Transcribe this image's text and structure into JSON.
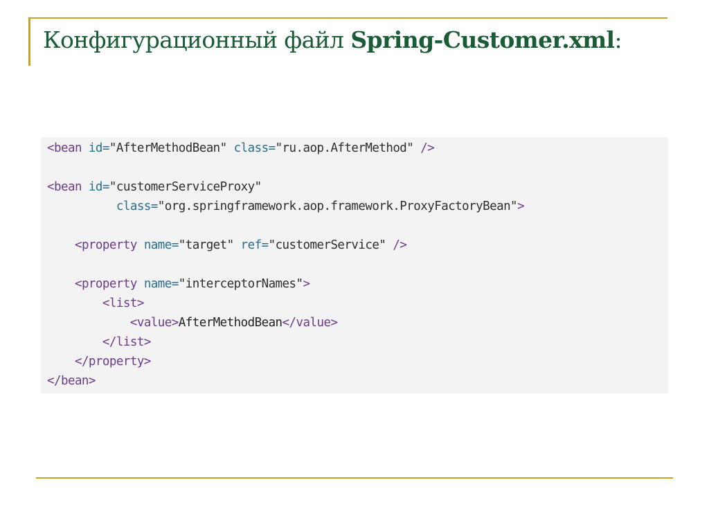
{
  "title": {
    "prefix": "Конфигурационный файл ",
    "filename": "Spring-Customer.xml",
    "suffix": ":"
  },
  "code": {
    "lines": [
      {
        "tokens": [
          {
            "t": "tag",
            "v": "<bean "
          },
          {
            "t": "attr",
            "v": "id="
          },
          {
            "t": "str",
            "v": "\"AfterMethodBean\" "
          },
          {
            "t": "attr",
            "v": "class="
          },
          {
            "t": "str",
            "v": "\"ru.aop.AfterMethod\" "
          },
          {
            "t": "tag",
            "v": "/>"
          }
        ]
      },
      {
        "tokens": []
      },
      {
        "tokens": [
          {
            "t": "tag",
            "v": "<bean "
          },
          {
            "t": "attr",
            "v": "id="
          },
          {
            "t": "str",
            "v": "\"customerServiceProxy\""
          }
        ]
      },
      {
        "tokens": [
          {
            "t": "txt",
            "v": "          "
          },
          {
            "t": "attr",
            "v": "class="
          },
          {
            "t": "str",
            "v": "\"org.springframework.aop.framework.ProxyFactoryBean\""
          },
          {
            "t": "tag",
            "v": ">"
          }
        ]
      },
      {
        "tokens": []
      },
      {
        "tokens": [
          {
            "t": "txt",
            "v": "    "
          },
          {
            "t": "tag",
            "v": "<property "
          },
          {
            "t": "attr",
            "v": "name="
          },
          {
            "t": "str",
            "v": "\"target\" "
          },
          {
            "t": "attr",
            "v": "ref="
          },
          {
            "t": "str",
            "v": "\"customerService\" "
          },
          {
            "t": "tag",
            "v": "/>"
          }
        ]
      },
      {
        "tokens": []
      },
      {
        "tokens": [
          {
            "t": "txt",
            "v": "    "
          },
          {
            "t": "tag",
            "v": "<property "
          },
          {
            "t": "attr",
            "v": "name="
          },
          {
            "t": "str",
            "v": "\"interceptorNames\""
          },
          {
            "t": "tag",
            "v": ">"
          }
        ]
      },
      {
        "tokens": [
          {
            "t": "txt",
            "v": "        "
          },
          {
            "t": "tag",
            "v": "<list>"
          }
        ]
      },
      {
        "tokens": [
          {
            "t": "txt",
            "v": "            "
          },
          {
            "t": "tag",
            "v": "<value>"
          },
          {
            "t": "txt",
            "v": "AfterMethodBean"
          },
          {
            "t": "tag",
            "v": "</value>"
          }
        ]
      },
      {
        "tokens": [
          {
            "t": "txt",
            "v": "        "
          },
          {
            "t": "tag",
            "v": "</list>"
          }
        ]
      },
      {
        "tokens": [
          {
            "t": "txt",
            "v": "    "
          },
          {
            "t": "tag",
            "v": "</property>"
          }
        ]
      },
      {
        "tokens": [
          {
            "t": "tag",
            "v": "</bean>"
          }
        ]
      }
    ]
  }
}
